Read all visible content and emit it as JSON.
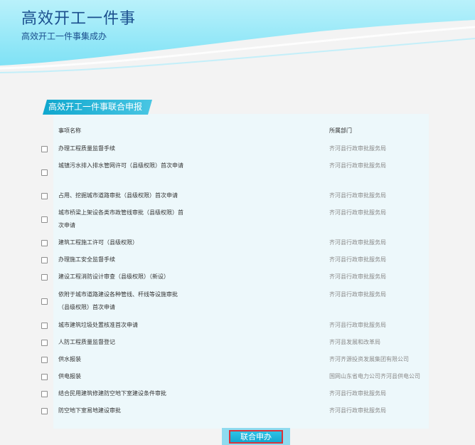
{
  "banner": {
    "title": "高效开工一件事",
    "subtitle": "高效开工一件事集成办"
  },
  "section": {
    "tab_label": "高效开工一件事联合申报"
  },
  "table": {
    "header_name": "事项名称",
    "header_dept": "所属部门",
    "rows": [
      {
        "name": "办理工程质量监督手续",
        "dept": "齐河县行政审批服务局"
      },
      {
        "name": "城镇污水排入排水管网许可（县级权限）首次申请",
        "dept": "齐河县行政审批服务局"
      },
      {
        "name": "占用、挖掘城市道路审批（县级权限）首次申请",
        "dept": "齐河县行政审批服务局"
      },
      {
        "name": "城市桥梁上架设各类市政管线审批（县级权限）首次申请",
        "dept": "齐河县行政审批服务局"
      },
      {
        "name": "建筑工程施工许可（县级权限）",
        "dept": "齐河县行政审批服务局"
      },
      {
        "name": "办理施工安全监督手续",
        "dept": "齐河县行政审批服务局"
      },
      {
        "name": "建设工程消防设计审查（县级权限）（新设）",
        "dept": "齐河县行政审批服务局"
      },
      {
        "name": "依附于城市道路建设各种管线、杆线等设施审批（县级权限）首次申请",
        "dept": "齐河县行政审批服务局"
      },
      {
        "name": "城市建筑垃圾处置核准首次申请",
        "dept": "齐河县行政审批服务局"
      },
      {
        "name": "人防工程质量监督登记",
        "dept": "齐河县发展和改革局"
      },
      {
        "name": "供水报装",
        "dept": "齐河齐源投资发展集团有限公司"
      },
      {
        "name": "供电报装",
        "dept": "国网山东省电力公司齐河县供电公司"
      },
      {
        "name": "结合民用建筑修建防空地下室建设条件审批",
        "dept": "齐河县行政审批服务局"
      },
      {
        "name": "防空地下室易地建设审批",
        "dept": "齐河县行政审批服务局"
      }
    ]
  },
  "actions": {
    "submit_label": "联合申办"
  }
}
